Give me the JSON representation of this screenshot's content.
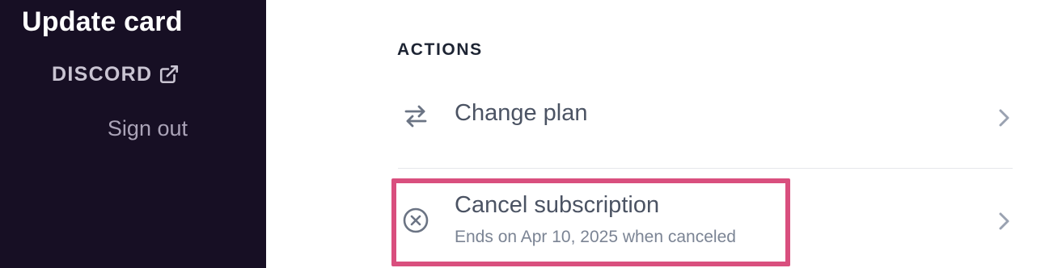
{
  "sidebar": {
    "title": "Update card",
    "discord_label": "DISCORD",
    "discord_icon": "external-link-icon",
    "signout_label": "Sign out"
  },
  "actions": {
    "heading": "ACTIONS",
    "items": [
      {
        "label": "Change plan",
        "icon": "swap-arrows-icon"
      },
      {
        "label": "Cancel subscription",
        "sublabel": "Ends on Apr 10, 2025 when canceled",
        "icon": "circle-x-icon",
        "highlighted": true
      }
    ]
  },
  "colors": {
    "sidebar_bg": "#170f24",
    "highlight": "#d94f7e",
    "text_primary": "#4b5363",
    "text_muted": "#7b8494",
    "icon": "#6b7484",
    "chevron": "#9aa2b1"
  }
}
